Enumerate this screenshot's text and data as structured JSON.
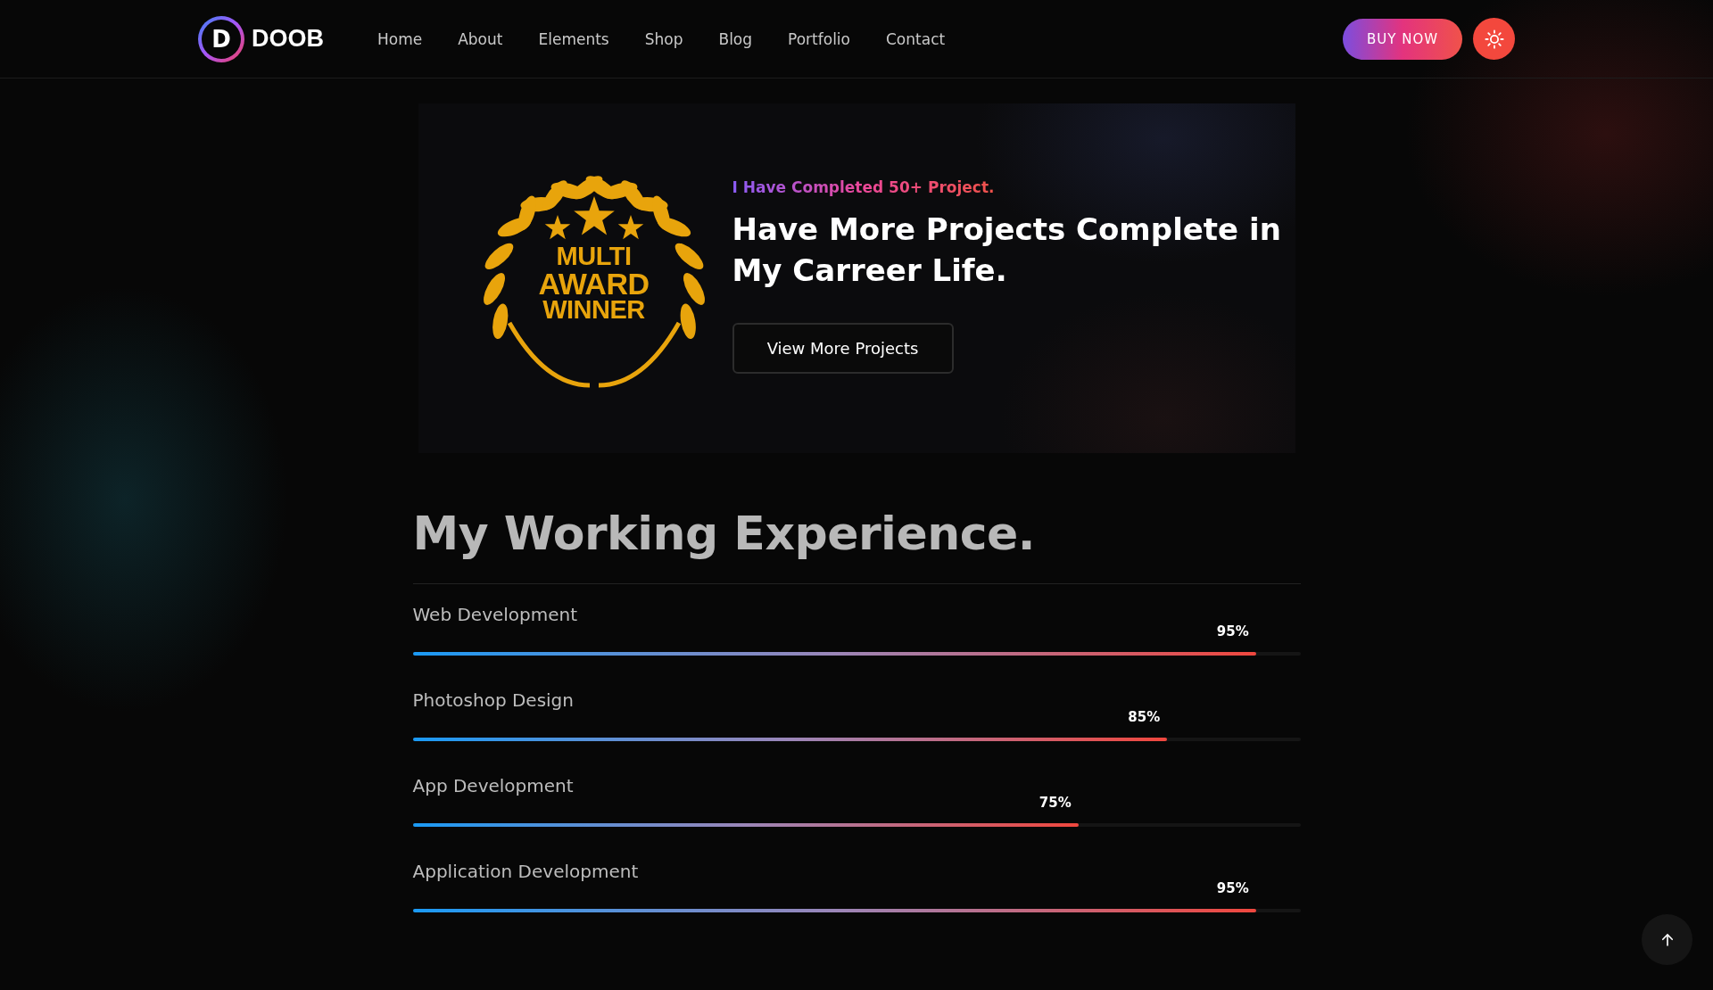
{
  "header": {
    "logo": {
      "letter": "D",
      "name": "DOOB"
    },
    "nav": [
      {
        "label": "Home"
      },
      {
        "label": "About"
      },
      {
        "label": "Elements"
      },
      {
        "label": "Shop"
      },
      {
        "label": "Blog"
      },
      {
        "label": "Portfolio"
      },
      {
        "label": "Contact"
      }
    ],
    "cta": "BUY NOW"
  },
  "award": {
    "badge_lines": [
      "MULTI",
      "AWARD",
      "WINNER"
    ],
    "subtitle": "I Have Completed 50+ Project.",
    "title": "Have More Projects Complete in My Carreer Life.",
    "button": "View More Projects"
  },
  "experience": {
    "title": "My Working Experience.",
    "skills": [
      {
        "name": "Web Development",
        "reading": "95%",
        "level": 0.95
      },
      {
        "name": "Photoshop Design",
        "reading": "85%",
        "level": 0.85
      },
      {
        "name": "App Development",
        "reading": "75%",
        "level": 0.75
      },
      {
        "name": "Application Development",
        "reading": "95%",
        "level": 0.95
      }
    ]
  }
}
